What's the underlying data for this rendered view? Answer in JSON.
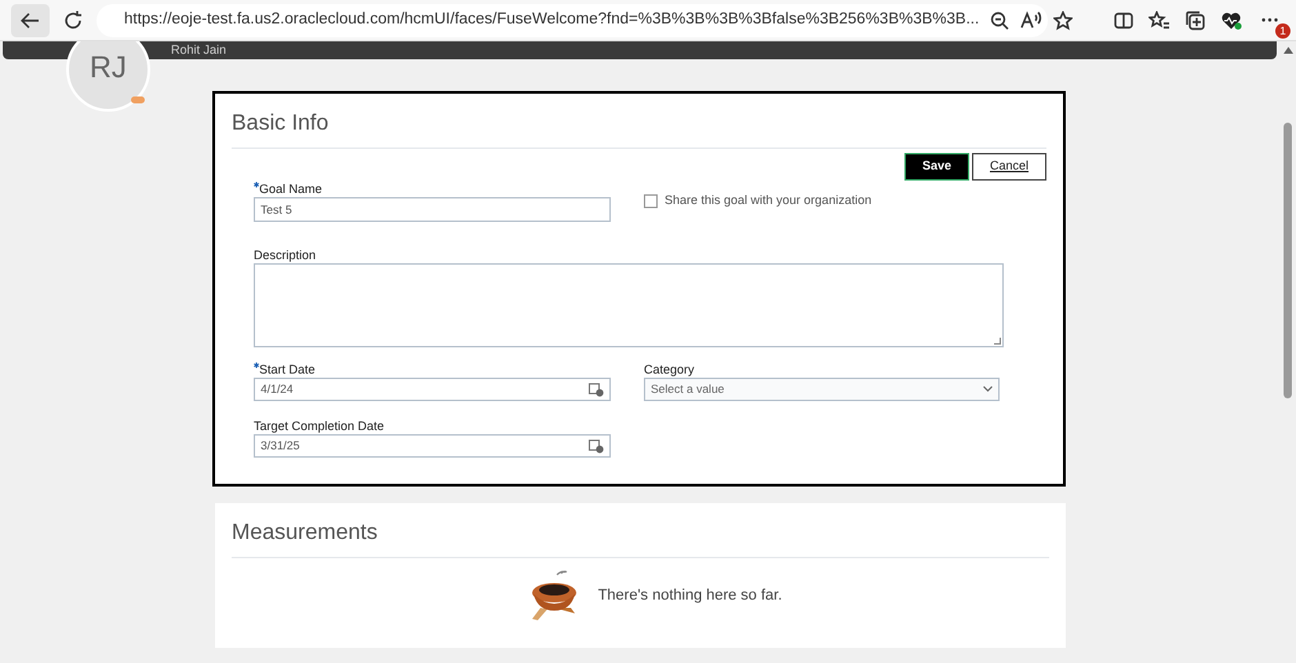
{
  "browser": {
    "url": "https://eoje-test.fa.us2.oraclecloud.com/hcmUI/faces/FuseWelcome?fnd=%3B%3B%3B%3Bfalse%3B256%3B%3B%3B...",
    "profile_badge": "1"
  },
  "header": {
    "avatar_initials": "RJ",
    "user_name": "Rohit Jain"
  },
  "basic_info": {
    "title": "Basic Info",
    "buttons": [
      {
        "label": "Save",
        "kind": "primary"
      },
      {
        "label": "Cancel",
        "kind": "secondary"
      }
    ],
    "fields": [
      {
        "kind": "text",
        "label": "Goal Name",
        "required": true,
        "value": "Test 5"
      },
      {
        "kind": "checkbox",
        "label": "Share this goal with your organization",
        "checked": false
      },
      {
        "kind": "textarea",
        "label": "Description",
        "required": false
      },
      {
        "kind": "date",
        "label": "Start Date",
        "required": true,
        "value": "4/1/24"
      },
      {
        "kind": "select",
        "label": "Category",
        "required": false,
        "placeholder": "Select a value"
      },
      {
        "kind": "date",
        "label": "Target Completion Date",
        "required": false,
        "value": "3/31/25"
      }
    ]
  },
  "measurements": {
    "title": "Measurements",
    "empty_message": "There's nothing here so far."
  }
}
